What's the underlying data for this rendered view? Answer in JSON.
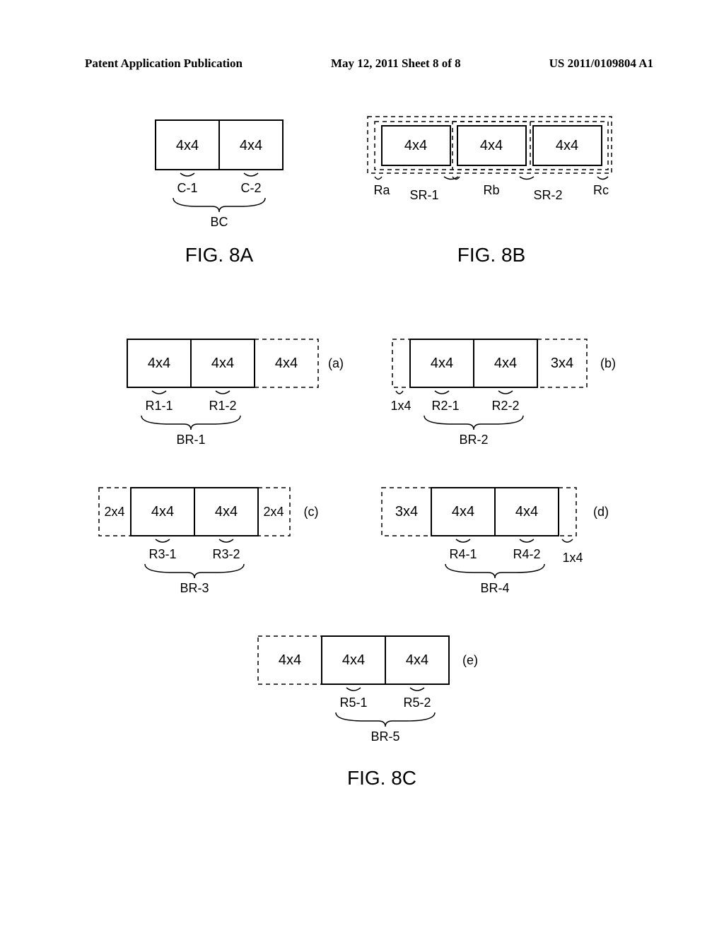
{
  "header": {
    "left": "Patent Application Publication",
    "center": "May 12, 2011  Sheet 8 of 8",
    "right": "US 2011/0109804 A1"
  },
  "fig8a": {
    "title": "FIG. 8A",
    "BC": "BC",
    "C1": "C-1",
    "C2": "C-2",
    "cell": "4x4"
  },
  "fig8b": {
    "title": "FIG. 8B",
    "SR1": "SR-1",
    "SR2": "SR-2",
    "Ra": "Ra",
    "Rb": "Rb",
    "Rc": "Rc",
    "cell": "4x4"
  },
  "fig8c": {
    "title": "FIG. 8C",
    "a": {
      "tag": "(a)",
      "R1": "R1-1",
      "R2": "R1-2",
      "BR": "BR-1",
      "c1": "4x4",
      "c2": "4x4",
      "c3": "4x4"
    },
    "b": {
      "tag": "(b)",
      "R1": "R2-1",
      "R2": "R2-2",
      "BR": "BR-2",
      "lead": "1x4",
      "c1": "4x4",
      "c2": "4x4",
      "c3": "3x4"
    },
    "c": {
      "tag": "(c)",
      "R1": "R3-1",
      "R2": "R3-2",
      "BR": "BR-3",
      "lead": "2x4",
      "c1": "4x4",
      "c2": "4x4",
      "c3": "2x4"
    },
    "d": {
      "tag": "(d)",
      "R1": "R4-1",
      "R2": "R4-2",
      "BR": "BR-4",
      "lead": "3x4",
      "c1": "4x4",
      "c2": "4x4",
      "trail": "1x4"
    },
    "e": {
      "tag": "(e)",
      "R1": "R5-1",
      "R2": "R5-2",
      "BR": "BR-5",
      "c1": "4x4",
      "c2": "4x4",
      "c3": "4x4"
    }
  },
  "chart_data": {
    "type": "table",
    "description": "Patent figure showing block partitioning schemes for video coding. Each diagram shows how blocks of pixels are divided into sub-blocks.",
    "figures": [
      {
        "id": "8A",
        "group": "BC",
        "blocks": [
          {
            "name": "C-1",
            "size": "4x4"
          },
          {
            "name": "C-2",
            "size": "4x4"
          }
        ]
      },
      {
        "id": "8B",
        "groups": [
          "SR-1",
          "SR-2"
        ],
        "regions": [
          "Ra",
          "Rb",
          "Rc"
        ],
        "blocks": [
          {
            "size": "4x4"
          },
          {
            "size": "4x4"
          },
          {
            "size": "4x4"
          }
        ]
      },
      {
        "id": "8C",
        "variants": [
          {
            "tag": "a",
            "group": "BR-1",
            "labels": [
              "R1-1",
              "R1-2"
            ],
            "cells": [
              "4x4",
              "4x4",
              "4x4"
            ]
          },
          {
            "tag": "b",
            "group": "BR-2",
            "labels": [
              "R2-1",
              "R2-2"
            ],
            "cells": [
              "1x4",
              "4x4",
              "4x4",
              "3x4"
            ]
          },
          {
            "tag": "c",
            "group": "BR-3",
            "labels": [
              "R3-1",
              "R3-2"
            ],
            "cells": [
              "2x4",
              "4x4",
              "4x4",
              "2x4"
            ]
          },
          {
            "tag": "d",
            "group": "BR-4",
            "labels": [
              "R4-1",
              "R4-2"
            ],
            "cells": [
              "3x4",
              "4x4",
              "4x4",
              "1x4"
            ]
          },
          {
            "tag": "e",
            "group": "BR-5",
            "labels": [
              "R5-1",
              "R5-2"
            ],
            "cells": [
              "4x4",
              "4x4",
              "4x4"
            ]
          }
        ]
      }
    ]
  }
}
